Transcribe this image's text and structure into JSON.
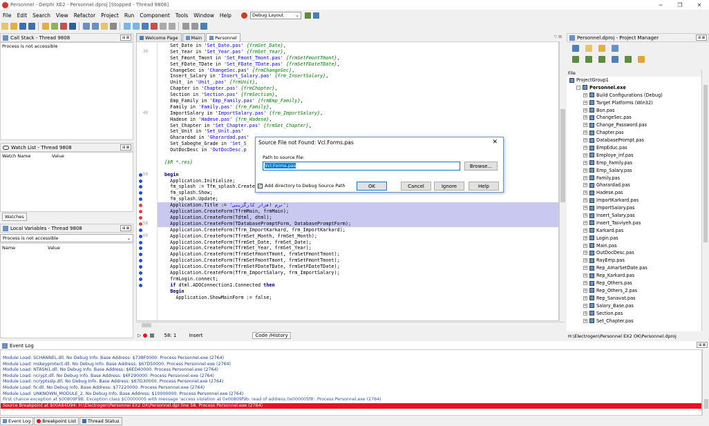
{
  "window": {
    "title": "Personnel - Delphi XE2 - Personnel.dproj [Stopped - Thread 9808]"
  },
  "menu": [
    "File",
    "Edit",
    "Search",
    "View",
    "Refactor",
    "Project",
    "Run",
    "Component",
    "Tools",
    "Window",
    "Help"
  ],
  "layout_combo": "Debug Layout",
  "panels": {
    "callstack": {
      "title": "Call Stack - Thread 9808",
      "msg": "Process is not accessible"
    },
    "watch": {
      "title": "Watch List - Thread 9808",
      "col_name": "Watch Name",
      "col_value": "Value",
      "tab": "Watches"
    },
    "locals": {
      "title": "Local Variables - Thread 9808",
      "combo": "Process is not accessible",
      "col_name": "Name",
      "col_value": "Value"
    }
  },
  "editor_tabs": [
    "Welcome Page",
    "Main",
    "Personnel"
  ],
  "code_lines": [
    {
      "no": "",
      "bp": "",
      "hl": false,
      "parts": [
        [
          "",
          "  Set_Date in "
        ],
        [
          "str",
          "'Set_Date.pas'"
        ],
        [
          "",
          " "
        ],
        [
          "cmt",
          "{frmSet_Date}"
        ],
        [
          "",
          ","
        ]
      ]
    },
    {
      "no": "30",
      "bp": "",
      "hl": false,
      "parts": [
        [
          "",
          "  Set_Year in "
        ],
        [
          "str",
          "'Set_Year.pas'"
        ],
        [
          "",
          " "
        ],
        [
          "cmt",
          "{frmSet_Year}"
        ],
        [
          "",
          ","
        ]
      ]
    },
    {
      "no": "",
      "bp": "",
      "hl": false,
      "parts": [
        [
          "",
          "  Set_Fmont_Tmont in "
        ],
        [
          "str",
          "'Set_Fmont_Tmont.pas'"
        ],
        [
          "",
          " "
        ],
        [
          "cmt",
          "{frmSetFmontTmont}"
        ],
        [
          "",
          ","
        ]
      ]
    },
    {
      "no": "",
      "bp": "",
      "hl": false,
      "parts": [
        [
          "",
          "  Set_FDate_TDate in "
        ],
        [
          "str",
          "'Set_FDate_TDate.pas'"
        ],
        [
          "",
          " "
        ],
        [
          "cmt",
          "{frmSetFDateTDate}"
        ],
        [
          "",
          ","
        ]
      ]
    },
    {
      "no": "",
      "bp": "",
      "hl": false,
      "parts": [
        [
          "",
          "  ChangeSec in "
        ],
        [
          "str",
          "'ChangeSec.pas'"
        ],
        [
          "",
          " "
        ],
        [
          "cmt",
          "{frmChangeSec}"
        ],
        [
          "",
          ","
        ]
      ]
    },
    {
      "no": "",
      "bp": "",
      "hl": false,
      "parts": [
        [
          "",
          "  Insert_Salary in "
        ],
        [
          "str",
          "'Insert_Salary.pas'"
        ],
        [
          "",
          " "
        ],
        [
          "cmt",
          "{frm_InsertSalary}"
        ],
        [
          "",
          ","
        ]
      ]
    },
    {
      "no": "",
      "bp": "",
      "hl": false,
      "parts": [
        [
          "",
          "  Unit_ in "
        ],
        [
          "str",
          "'Unit_.pas'"
        ],
        [
          "",
          " "
        ],
        [
          "cmt",
          "{frmUnit}"
        ],
        [
          "",
          ","
        ]
      ]
    },
    {
      "no": "",
      "bp": "",
      "hl": false,
      "parts": [
        [
          "",
          "  Chapter in "
        ],
        [
          "str",
          "'Chapter.pas'"
        ],
        [
          "",
          " "
        ],
        [
          "cmt",
          "{frmChapter}"
        ],
        [
          "",
          ","
        ]
      ]
    },
    {
      "no": "",
      "bp": "",
      "hl": false,
      "parts": [
        [
          "",
          "  Section in "
        ],
        [
          "str",
          "'Section.pas'"
        ],
        [
          "",
          " "
        ],
        [
          "cmt",
          "{frmSection}"
        ],
        [
          "",
          ","
        ]
      ]
    },
    {
      "no": "",
      "bp": "",
      "hl": false,
      "parts": [
        [
          "",
          "  Emp_Family in "
        ],
        [
          "str",
          "'Emp_Family.pas'"
        ],
        [
          "",
          " "
        ],
        [
          "cmt",
          "{frmEmp_Family}"
        ],
        [
          "",
          ","
        ]
      ]
    },
    {
      "no": "",
      "bp": "",
      "hl": false,
      "parts": [
        [
          "",
          "  Family in "
        ],
        [
          "str",
          "'Family.pas'"
        ],
        [
          "",
          " "
        ],
        [
          "cmt",
          "{frm_Family}"
        ],
        [
          "",
          ","
        ]
      ]
    },
    {
      "no": "40",
      "bp": "",
      "hl": false,
      "parts": [
        [
          "",
          "  ImportSalary in "
        ],
        [
          "str",
          "'ImportSalary.pas'"
        ],
        [
          "",
          " "
        ],
        [
          "cmt",
          "{frm_ImportSalary}"
        ],
        [
          "",
          ","
        ]
      ]
    },
    {
      "no": "",
      "bp": "",
      "hl": false,
      "parts": [
        [
          "",
          "  Hadese in "
        ],
        [
          "str",
          "'Hadese.pas'"
        ],
        [
          "",
          " "
        ],
        [
          "cmt",
          "{frm_Hadese}"
        ],
        [
          "",
          ","
        ]
      ]
    },
    {
      "no": "",
      "bp": "",
      "hl": false,
      "parts": [
        [
          "",
          "  Set_Chapter in "
        ],
        [
          "str",
          "'Set_Chapter.pas'"
        ],
        [
          "",
          " "
        ],
        [
          "cmt",
          "{frmSet_Chapter}"
        ],
        [
          "",
          ","
        ]
      ]
    },
    {
      "no": "",
      "bp": "",
      "hl": false,
      "parts": [
        [
          "",
          "  Set_Unit in "
        ],
        [
          "str",
          "'Set_Unit.pas'"
        ]
      ]
    },
    {
      "no": "",
      "bp": "",
      "hl": false,
      "parts": [
        [
          "",
          "  Gharardad in "
        ],
        [
          "str",
          "'Gharardad.pas'"
        ]
      ]
    },
    {
      "no": "",
      "bp": "",
      "hl": false,
      "parts": [
        [
          "",
          "  Set_Sabeghe_Grade in "
        ],
        [
          "str",
          "'Set_S"
        ]
      ]
    },
    {
      "no": "",
      "bp": "",
      "hl": false,
      "parts": [
        [
          "",
          "  OutDocDesc in "
        ],
        [
          "str",
          "'OutDocDesc.p"
        ]
      ]
    },
    {
      "no": "",
      "bp": "",
      "hl": false,
      "parts": [
        [
          "",
          ""
        ]
      ]
    },
    {
      "no": "",
      "bp": "",
      "hl": false,
      "parts": [
        [
          "cmt",
          "{$R *.res}"
        ]
      ]
    },
    {
      "no": "",
      "bp": "",
      "hl": false,
      "parts": [
        [
          "",
          ""
        ]
      ]
    },
    {
      "no": "50",
      "bp": "dot",
      "hl": false,
      "parts": [
        [
          "kw",
          "begin"
        ]
      ]
    },
    {
      "no": "",
      "bp": "dot",
      "hl": false,
      "parts": [
        [
          "",
          "  Application.Initialize;"
        ]
      ]
    },
    {
      "no": "",
      "bp": "dot",
      "hl": false,
      "parts": [
        [
          "",
          "  fm_splash := Tfm_splash.Create(Application);"
        ]
      ]
    },
    {
      "no": "",
      "bp": "dot",
      "hl": false,
      "parts": [
        [
          "",
          "  fm_splash.Show;"
        ]
      ]
    },
    {
      "no": "",
      "bp": "dot",
      "hl": false,
      "parts": [
        [
          "",
          "  fm_splash.Update;"
        ]
      ]
    },
    {
      "no": "",
      "bp": "chk",
      "hl": true,
      "parts": [
        [
          "",
          "  Application.Title := "
        ],
        [
          "str",
          "'نرم افزار کارگزینی'"
        ],
        [
          "",
          ";"
        ]
      ]
    },
    {
      "no": "",
      "bp": "chk",
      "hl": true,
      "parts": [
        [
          "",
          "  Application.CreateForm(TfrmMain, frmMain);"
        ]
      ]
    },
    {
      "no": "",
      "bp": "chk",
      "hl": true,
      "parts": [
        [
          "",
          "  Application.CreateForm(Tdtml, dtml);"
        ]
      ]
    },
    {
      "no": "58",
      "bp": "chk",
      "hl": true,
      "parts": [
        [
          "",
          "  Application.CreateForm(TDatabasePromptForm, DatabasePromptForm);"
        ]
      ]
    },
    {
      "no": "",
      "bp": "dot",
      "hl": false,
      "parts": [
        [
          "",
          "  Application.CreateForm(Tfrm_ImportKarkard, frm_ImportKarkard);"
        ]
      ]
    },
    {
      "no": "60",
      "bp": "dot",
      "hl": false,
      "parts": [
        [
          "",
          "  Application.CreateForm(TfrmSet_Month, frmSet_Month);"
        ]
      ]
    },
    {
      "no": "",
      "bp": "dot",
      "hl": false,
      "parts": [
        [
          "",
          "  Application.CreateForm(TfrmSet_Date, frmSet_Date);"
        ]
      ]
    },
    {
      "no": "",
      "bp": "dot",
      "hl": false,
      "parts": [
        [
          "",
          "  Application.CreateForm(TfrmSet_Year, frmSet_Year);"
        ]
      ]
    },
    {
      "no": "",
      "bp": "dot",
      "hl": false,
      "parts": [
        [
          "",
          "  Application.CreateForm(TfrmSetFmontTmont, frmSetFmontTmont);"
        ]
      ]
    },
    {
      "no": "",
      "bp": "dot",
      "hl": false,
      "parts": [
        [
          "",
          "  Application.CreateForm(TfrmSetFmontTmont, frmSetFmontTmont);"
        ]
      ]
    },
    {
      "no": "",
      "bp": "dot",
      "hl": false,
      "parts": [
        [
          "",
          "  Application.CreateForm(TfrmSetFDateTDate, frmSetFDateTDate);"
        ]
      ]
    },
    {
      "no": "",
      "bp": "dot",
      "hl": false,
      "parts": [
        [
          "",
          "  Application.CreateForm(Tfrm_ImportSalary, frm_ImportSalary);"
        ]
      ]
    },
    {
      "no": "",
      "bp": "dot",
      "hl": false,
      "parts": [
        [
          "",
          "  frmLogin.connect;"
        ]
      ]
    },
    {
      "no": "",
      "bp": "dot",
      "hl": false,
      "parts": [
        [
          "",
          "  "
        ],
        [
          "kw",
          "if"
        ],
        [
          "",
          " dtml.ADOConnection1.Connected "
        ],
        [
          "kw",
          "then"
        ]
      ]
    },
    {
      "no": "",
      "bp": "",
      "hl": false,
      "parts": [
        [
          "",
          "  "
        ],
        [
          "kw",
          "Begin"
        ]
      ]
    },
    {
      "no": "",
      "bp": "",
      "hl": false,
      "parts": [
        [
          "",
          "    Application.ShowMainForm := false;"
        ]
      ]
    }
  ],
  "statusbar": {
    "pos": "58: 1",
    "mode": "Insert",
    "tabs": "Code /History"
  },
  "dialog": {
    "title": "Source File not Found: Vcl.Forms.pas",
    "label": "Path to source file:",
    "value": "Vcl.Forms.pas",
    "browse": "Browse...",
    "checkbox": "Add directory to Debug Source Path",
    "ok": "OK",
    "cancel": "Cancel",
    "ignore": "Ignore",
    "help": "Help"
  },
  "project_manager": {
    "title": "Personnel.dproj - Project Manager",
    "file_label": "File",
    "path": "H:\\Electrogen\\Personnel EX2 OK\\Personnel.dproj",
    "items": [
      {
        "lvl": 0,
        "exp": "",
        "t": "ProjectGroup1",
        "bold": false
      },
      {
        "lvl": 1,
        "exp": "-",
        "t": "Personnel.exe",
        "bold": true
      },
      {
        "lvl": 2,
        "exp": "+",
        "t": "Build Configurations (Debug)",
        "bold": false
      },
      {
        "lvl": 2,
        "exp": "+",
        "t": "Target Platforms (Win32)",
        "bold": false
      },
      {
        "lvl": 2,
        "exp": "+",
        "t": "Bon.pas",
        "bold": false
      },
      {
        "lvl": 2,
        "exp": "+",
        "t": "ChangeSec.pas",
        "bold": false
      },
      {
        "lvl": 2,
        "exp": "+",
        "t": "Change_Password.pas",
        "bold": false
      },
      {
        "lvl": 2,
        "exp": "+",
        "t": "Chapter.pas",
        "bold": false
      },
      {
        "lvl": 2,
        "exp": "+",
        "t": "DatabasePrompt.pas",
        "bold": false
      },
      {
        "lvl": 2,
        "exp": "+",
        "t": "EmpEduc.pas",
        "bold": false
      },
      {
        "lvl": 2,
        "exp": "+",
        "t": "Employe_inf.pas",
        "bold": false
      },
      {
        "lvl": 2,
        "exp": "+",
        "t": "Emp_Family.pas",
        "bold": false
      },
      {
        "lvl": 2,
        "exp": "+",
        "t": "Emp_Salary.pas",
        "bold": false
      },
      {
        "lvl": 2,
        "exp": "+",
        "t": "Family.pas",
        "bold": false
      },
      {
        "lvl": 2,
        "exp": "+",
        "t": "Gharardad.pas",
        "bold": false
      },
      {
        "lvl": 2,
        "exp": "+",
        "t": "Hadese.pas",
        "bold": false
      },
      {
        "lvl": 2,
        "exp": "+",
        "t": "ImportKarkard.pas",
        "bold": false
      },
      {
        "lvl": 2,
        "exp": "+",
        "t": "ImportSalary.pas",
        "bold": false
      },
      {
        "lvl": 2,
        "exp": "+",
        "t": "Insert_Salary.pas",
        "bold": false
      },
      {
        "lvl": 2,
        "exp": "+",
        "t": "Insert_Tasviyeh.pas",
        "bold": false
      },
      {
        "lvl": 2,
        "exp": "+",
        "t": "Karkard.pas",
        "bold": false
      },
      {
        "lvl": 2,
        "exp": "+",
        "t": "Login.pas",
        "bold": false
      },
      {
        "lvl": 2,
        "exp": "+",
        "t": "Main.pas",
        "bold": false
      },
      {
        "lvl": 2,
        "exp": "+",
        "t": "OutDocDesc.pas",
        "bold": false
      },
      {
        "lvl": 2,
        "exp": "+",
        "t": "RayEmp.pas",
        "bold": false
      },
      {
        "lvl": 2,
        "exp": "+",
        "t": "Rep_AmarSetDate.pas",
        "bold": false
      },
      {
        "lvl": 2,
        "exp": "+",
        "t": "Rep_Karkard.pas",
        "bold": false
      },
      {
        "lvl": 2,
        "exp": "+",
        "t": "Rep_Others.pas",
        "bold": false
      },
      {
        "lvl": 2,
        "exp": "+",
        "t": "Rep_Others_2.pas",
        "bold": false
      },
      {
        "lvl": 2,
        "exp": "+",
        "t": "Rep_Sanavat.pas",
        "bold": false
      },
      {
        "lvl": 2,
        "exp": "+",
        "t": "Salary_Base.pas",
        "bold": false
      },
      {
        "lvl": 2,
        "exp": "+",
        "t": "Section.pas",
        "bold": false
      },
      {
        "lvl": 2,
        "exp": "+",
        "t": "Set_Chapter.pas",
        "bold": false
      }
    ]
  },
  "event_log": {
    "title": "Event Log",
    "lines": [
      {
        "c": "",
        "t": "Module Load: SCHANNEL.dll. No Debug Info. Base Address: $738F0000. Process Personnel.exe (2764)"
      },
      {
        "c": "",
        "t": "Module Load: mskeyprotect.dll. No Debug Info. Base Address: $67D50000. Process Personnel.exe (2764)"
      },
      {
        "c": "",
        "t": "Module Load: NTASN1.dll. No Debug Info. Base Address: $6ED40000. Process Personnel.exe (2764)"
      },
      {
        "c": "",
        "t": "Module Load: ncrypt.dll. No Debug Info. Base Address: $6F290000. Process Personnel.exe (2764)"
      },
      {
        "c": "",
        "t": "Module Load: ncryptsslp.dll. No Debug Info. Base Address: $67D30000. Process Personnel.exe (2764)"
      },
      {
        "c": "",
        "t": "Module Load: fx.dll. No Debug Info. Base Address: $77220000. Process Personnel.exe (2764)"
      },
      {
        "c": "",
        "t": "Module Load: UNKNOWN_MODULE_2. No Debug Info. Base Address: $10000000. Process Personnel.exe (2764)"
      },
      {
        "c": "warn",
        "t": "First chance exception at $00809F9B. Exception class $C0000005 with message 'access violation at 0x00809f9b: read of address 0x000005f8'. Process Personnel.exe (2764)"
      },
      {
        "c": "red",
        "t": "Source Breakpoint at $00A84D94: H:\\Electrogen\\Personnel EX2 OK\\Personnel.dpr line 58. Process Personnel.exe (2764)"
      }
    ]
  },
  "bottom_tabs": [
    "Event Log",
    "Breakpoint List",
    "Thread Status"
  ]
}
